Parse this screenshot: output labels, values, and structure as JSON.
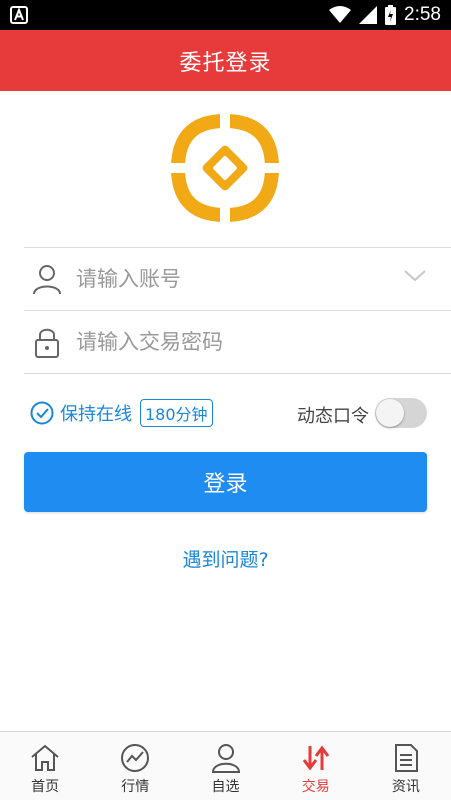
{
  "status_bar": {
    "time": "2:58"
  },
  "header": {
    "title": "委托登录"
  },
  "form": {
    "account_placeholder": "请输入账号",
    "password_placeholder": "请输入交易密码"
  },
  "options": {
    "keep_online_label": "保持在线",
    "keep_online_duration": "180分钟",
    "keep_online_checked": true,
    "dynamic_token_label": "动态口令",
    "dynamic_token_on": false
  },
  "login_button": {
    "label": "登录"
  },
  "help_link": {
    "label": "遇到问题?"
  },
  "tabbar": {
    "items": [
      {
        "label": "首页",
        "icon": "home-icon",
        "active": false
      },
      {
        "label": "行情",
        "icon": "market-chart-icon",
        "active": false
      },
      {
        "label": "自选",
        "icon": "user-favorites-icon",
        "active": false
      },
      {
        "label": "交易",
        "icon": "trade-arrows-icon",
        "active": true
      },
      {
        "label": "资讯",
        "icon": "news-document-icon",
        "active": false
      }
    ]
  },
  "colors": {
    "header_bg": "#e73b3b",
    "primary_blue": "#1e8cf0",
    "link_blue": "#1a87d9",
    "logo_gold": "#f2a916",
    "active_tab_red": "#e73b3b"
  }
}
